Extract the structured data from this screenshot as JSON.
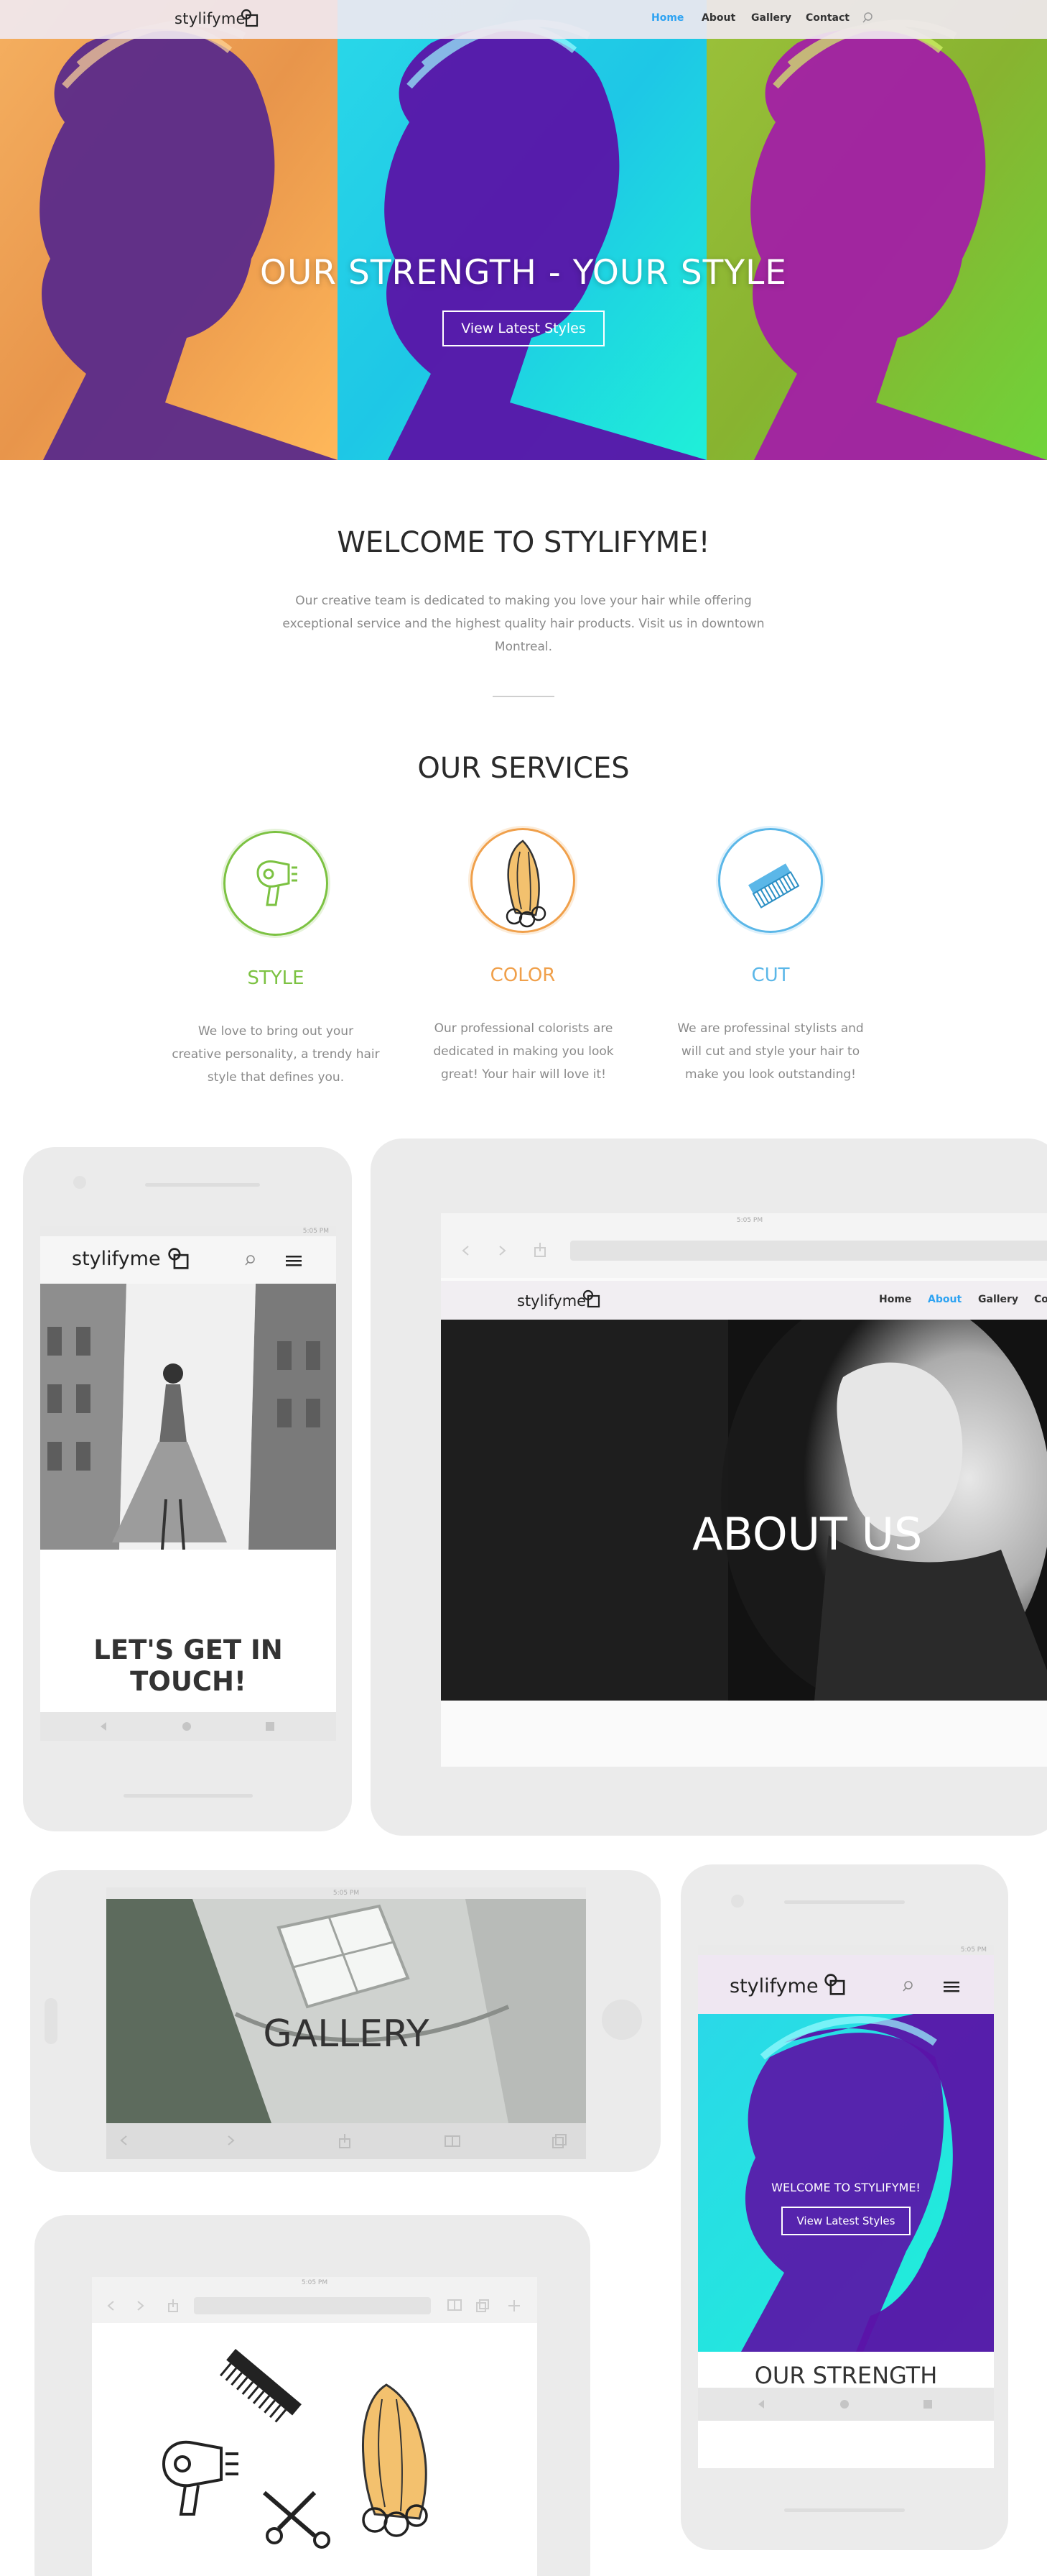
{
  "colors": {
    "accent": "#2ea3f2",
    "style_green": "#7cc242",
    "color_orange": "#f0a04b",
    "cut_blue": "#5bb7e8"
  },
  "header": {
    "logo": "stylifyme",
    "nav": [
      "Home",
      "About",
      "Gallery",
      "Contact"
    ],
    "active_nav": "Home",
    "search_icon": "search-icon"
  },
  "hero": {
    "title": "OUR STRENGTH - YOUR STYLE",
    "button": "View Latest Styles"
  },
  "welcome": {
    "title": "WELCOME TO STYLIFYME!",
    "text": "Our creative team is dedicated to making you love your hair while offering exceptional service and the highest quality hair products. Visit us in downtown Montreal."
  },
  "services": {
    "title": "OUR SERVICES",
    "items": [
      {
        "title": "STYLE",
        "icon": "hair-dryer-icon",
        "text": "We love to bring out your creative personality, a trendy hair style that defines you."
      },
      {
        "title": "COLOR",
        "icon": "hair-lock-icon",
        "text": "Our professional colorists are dedicated in making you look great! Your hair will love it!"
      },
      {
        "title": "CUT",
        "icon": "comb-icon",
        "text": "We are professinal stylists and will cut and style your hair to make you look outstanding!"
      }
    ]
  },
  "mockups": {
    "phone1": {
      "logo": "stylifyme",
      "status_time": "5:05 PM",
      "caption": "LET'S GET IN TOUCH!"
    },
    "tablet1": {
      "status_time": "5:05 PM",
      "logo": "stylifyme",
      "nav": [
        "Home",
        "About",
        "Gallery",
        "Co"
      ],
      "active_nav": "About",
      "caption": "ABOUT US"
    },
    "tablet2": {
      "status_time": "5:05 PM",
      "caption": "GALLERY"
    },
    "phone2": {
      "status_time": "5:05 PM",
      "logo": "stylifyme",
      "welcome": "WELCOME TO STYLIFYME!",
      "button": "View Latest Styles",
      "partial_heading": "OUR STRENGTH"
    },
    "tablet3": {
      "status_time": "5:05 PM"
    }
  }
}
